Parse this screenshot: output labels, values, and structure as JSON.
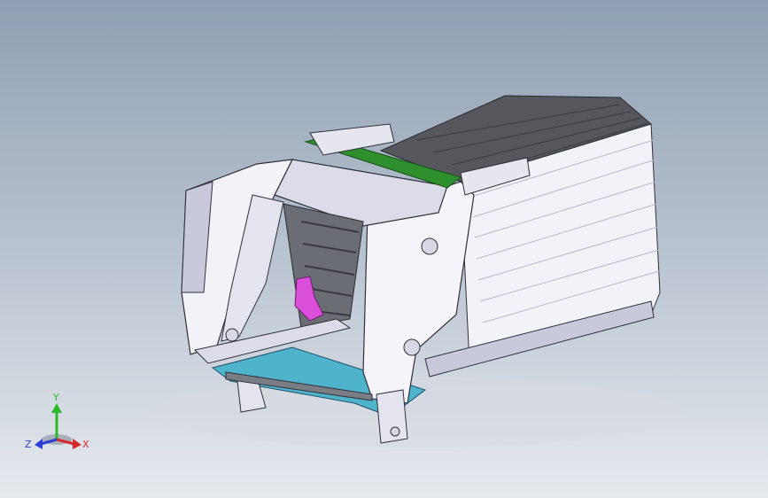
{
  "viewport": {
    "background_top": "#8f9fb3",
    "background_bottom": "#e6e9ee"
  },
  "model": {
    "body_color": "#f2f2f8",
    "shadow_color": "#c9c9dc",
    "dark_panel_color": "#55575c",
    "belt_color": "#2f8f2f",
    "basin_color": "#4fb3cc",
    "hook_color": "#d94fd9"
  },
  "triad": {
    "x_label": "X",
    "y_label": "Y",
    "z_label": "Z",
    "x_color": "#d42a2a",
    "y_color": "#2eb82e",
    "z_color": "#2a3fd4"
  }
}
